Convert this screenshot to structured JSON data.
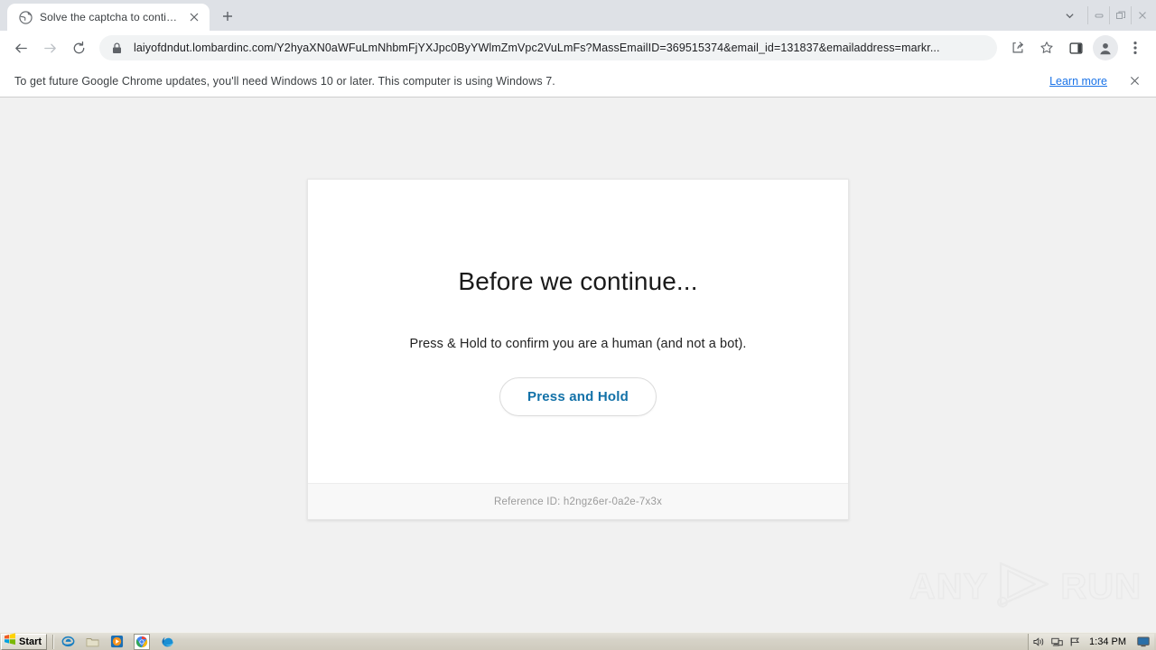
{
  "browser": {
    "tab": {
      "favicon": "globe-icon",
      "title": "Solve the captcha to continue",
      "close_label": "✕",
      "newtab_label": "+"
    },
    "tabstrip": {
      "tab_search_icon": "chevron-down-icon"
    },
    "window_controls": {
      "minimize": "minimize-icon",
      "restore": "restore-icon",
      "close": "close-icon"
    },
    "toolbar": {
      "back_icon": "arrow-left-icon",
      "forward_icon": "arrow-right-icon",
      "reload_icon": "reload-icon",
      "lock_icon": "lock-icon",
      "url": "laiyofdndut.lombardinc.com/Y2hyaXN0aWFuLmNhbmFjYXJpc0ByYWlmZmVpc2VuLmFs?MassEmailID=369515374&email_id=131837&emailaddress=markr...",
      "share_icon": "share-icon",
      "bookmark_icon": "star-icon",
      "sidepanel_icon": "side-panel-icon",
      "profile_icon": "account-avatar-icon",
      "menu_icon": "three-dot-menu-icon"
    },
    "infobar": {
      "message": "To get future Google Chrome updates, you'll need Windows 10 or later. This computer is using Windows 7.",
      "link_label": "Learn more",
      "close_label": "✕"
    }
  },
  "page": {
    "card": {
      "title": "Before we continue...",
      "subtitle": "Press & Hold to confirm you are a human (and not a bot).",
      "button_label": "Press and Hold",
      "footer_text": "Reference ID: h2ngz6er-0a2e-7x3x"
    },
    "watermark": {
      "left_word": "ANY",
      "right_word": "RUN",
      "logo_icon": "play-triangle-icon"
    }
  },
  "taskbar": {
    "start_label": "Start",
    "start_icon": "windows-logo-icon",
    "quicklaunch": [
      {
        "name": "internet-explorer-icon",
        "label": "Internet Explorer"
      },
      {
        "name": "folder-icon",
        "label": "File Explorer"
      },
      {
        "name": "media-player-icon",
        "label": "Windows Media Player"
      },
      {
        "name": "google-chrome-icon",
        "label": "Google Chrome"
      },
      {
        "name": "microsoft-edge-icon",
        "label": "Microsoft Edge"
      }
    ],
    "tray": {
      "volume_icon": "volume-icon",
      "network_icon": "network-icon",
      "flag_icon": "flag-icon",
      "time": "1:34 PM",
      "show_desktop_icon": "show-desktop-icon"
    }
  },
  "colors": {
    "tabstrip_bg": "#dee1e6",
    "page_bg": "#f1f1f1",
    "card_bg": "#ffffff",
    "button_text": "#1271a8",
    "link_blue": "#1a73e8",
    "taskbar_bg": "#d6d3c8"
  }
}
